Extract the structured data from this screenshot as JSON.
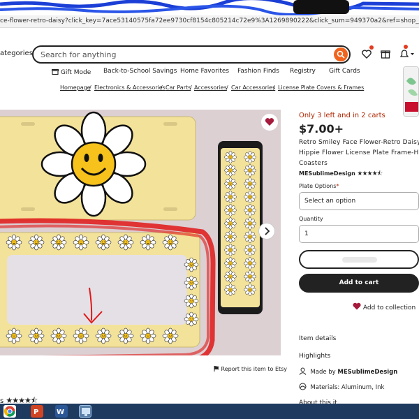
{
  "browser": {
    "url": "ce-flower-retro-daisy?click_key=7ace53140575fa72ee9730cf8154c805214c72e9%3A1269890222&click_sum=949370a2&ref=shop_home_active_42&frs=1"
  },
  "header": {
    "categories_label": "ategories",
    "search_placeholder": "Search for anything",
    "icons": [
      "search-icon",
      "heart-icon",
      "gift-icon",
      "bell-icon"
    ]
  },
  "nav": {
    "items": [
      "Gift Mode",
      "Back-to-School Savings",
      "Home Favorites",
      "Fashion Finds",
      "Registry",
      "Gift Cards"
    ]
  },
  "breadcrumbs": [
    "Homepage",
    "Electronics & Accessories",
    "Car Parts",
    "Accessories",
    "Car Accessories",
    "License Plate Covers & Frames"
  ],
  "gallery": {
    "report_label": "Report this item to Etsy"
  },
  "product": {
    "urgency": "Only 3 left and in 2 carts",
    "price": "$7.00+",
    "title_lines": [
      "Retro Smiley Face Flower-Retro Daisy Lic",
      "Hippie Flower License Plate Frame-Hipp",
      "Coasters"
    ],
    "shop_name": "MESublimeDesign",
    "shop_stars": "★★★★⯪",
    "option_label": "Plate Options",
    "option_required": "*",
    "option_placeholder": "Select an option",
    "quantity_label": "Quantity",
    "quantity_value": "1",
    "add_to_cart": "Add to cart",
    "add_to_collection": "Add to collection"
  },
  "info": {
    "details": "Item details",
    "highlights": "Highlights",
    "designed_by_prefix": "Made by",
    "designed_by": "MESublimeDesign",
    "materials": "Materials: Aluminum, Ink",
    "about": "About this it"
  },
  "reviews": {
    "prefix": "s",
    "stars": "★★★★⯪"
  },
  "colors": {
    "accent": "#f1641e",
    "urgency": "#b12704",
    "dark": "#222222",
    "plate_yellow": "#f3e29a",
    "annotation_red": "#e01818"
  }
}
